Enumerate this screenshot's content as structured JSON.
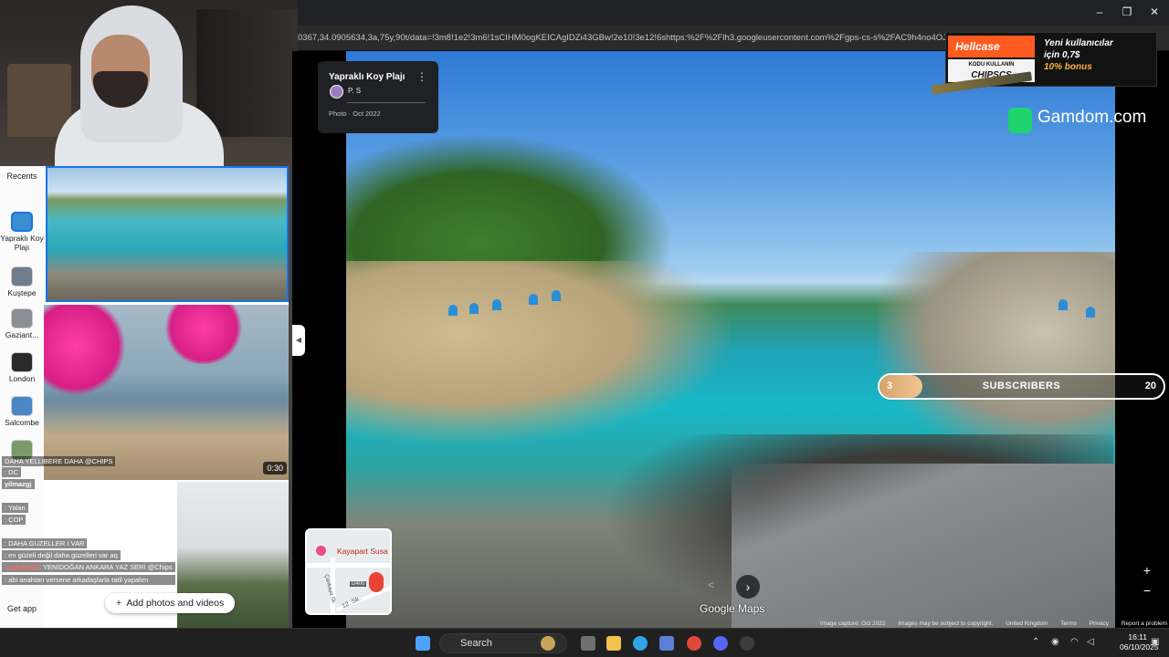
{
  "browser": {
    "url": "0367,34.0905634,3a,75y,90t/data=!3m8!1e2!3m6!1sCIHM0ogKEICAgIDZi43GBw!2e10!3e12!6shttps:%2F%2Flh3.googleusercontent.com%2Fgps-cs-s%2FAC9h4no4OJywiAt-YK",
    "window_controls": [
      "–",
      "❐",
      "✕"
    ]
  },
  "sidebar": {
    "recents_label": "Recents",
    "items": [
      {
        "label": "Yapraklı Koy Plajı",
        "color": "#3a8fd1"
      },
      {
        "label": "Kuştepe",
        "color": "#6f7d8c"
      },
      {
        "label": "Gaziant...",
        "color": "#8a8f96"
      },
      {
        "label": "London",
        "color": "#2a2a2a"
      },
      {
        "label": "Salcombe",
        "color": "#4c86c4"
      }
    ],
    "getapp_label": "Get app"
  },
  "photos": {
    "video_duration": "0:30",
    "add_button_label": "Add photos and videos"
  },
  "chat": [
    {
      "user": "",
      "text": "DAHA YELLIBERE DAHA @CHIPS"
    },
    {
      "user": "",
      "text": ": DC"
    },
    {
      "user": "yilmazgj",
      "text": ""
    },
    {
      "user": "",
      "text": ""
    },
    {
      "user": "",
      "text": ": Yalan"
    },
    {
      "user": "",
      "text": ": ÇOP"
    },
    {
      "user": "",
      "text": ""
    },
    {
      "user": "",
      "text": ": DAHA GUZELLER I VAR"
    },
    {
      "user": "",
      "text": ": en güzeli değil daha güzelleri var aq"
    },
    {
      "user": "Laykaaa26",
      "text": ": YENİDOĞAN ANKARA YAZ SERİ @Chips"
    },
    {
      "user": "",
      "text": ": abi anahtan versene arkadaşlarla tatil yapalım"
    }
  ],
  "info_card": {
    "title": "Yapraklı Koy Plajı",
    "author": "P. S",
    "date": "Photo · Oct 2022"
  },
  "ads": {
    "hellcase": {
      "brand": "Hellcase",
      "code_label": "KODU KULLANIN",
      "code": "CHIPSCS",
      "line1": "Yeni kullanıcılar",
      "line2": "için 0,7$",
      "line3": "10% bonus"
    },
    "gamdom": "Gamdom.com"
  },
  "subscribers": {
    "label": "SUBSCRIBERS",
    "current": "3",
    "goal": "20",
    "progress": 0.15
  },
  "minimap": {
    "place": "Kayapart Susa",
    "road_badge": "D400",
    "street1": "Çankaya Sk.",
    "street2": "12. Sk."
  },
  "viewer": {
    "logo": "Google Maps",
    "zoom_in": "+",
    "zoom_out": "−",
    "credits": [
      "Image capture: Oct 2022",
      "Images may be subject to copyright.",
      "United Kingdom",
      "Terms",
      "Privacy",
      "Report a problem"
    ]
  },
  "taskbar": {
    "search_label": "Search",
    "time": "16:11",
    "date": "06/10/2025"
  },
  "colors": {
    "accent": "#1a73e8",
    "subs_fill": "#e5b07a",
    "gamdom": "#1fd36f",
    "hellcase": "#ff5a1f"
  }
}
